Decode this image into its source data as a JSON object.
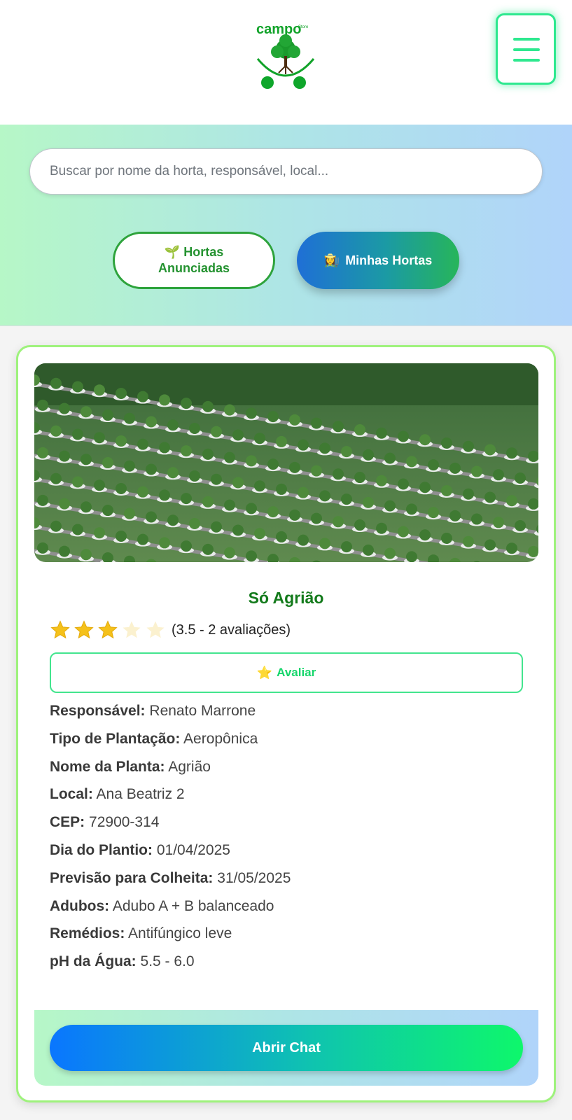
{
  "header": {
    "logo_text": "campo",
    "logo_subtext": "Store",
    "menu_icon": "hamburger-menu-icon"
  },
  "search": {
    "placeholder": "Buscar por nome da horta, responsável, local..."
  },
  "tabs": {
    "anunciadas": {
      "icon": "🌱",
      "label_line1": "Hortas",
      "label_line2": "Anunciadas"
    },
    "minhas": {
      "icon": "👩‍🌾",
      "label": "Minhas Hortas"
    }
  },
  "card": {
    "image_alt": "aeroponic watercress plantation",
    "title": "Só Agrião",
    "rating": {
      "value": 3.5,
      "stars_total": 5,
      "stars_filled": 3,
      "text": "(3.5 - 2 avaliações)"
    },
    "avaliar": {
      "icon": "⭐",
      "label": "Avaliar"
    },
    "details": [
      {
        "label": "Responsável:",
        "value": "Renato Marrone"
      },
      {
        "label": "Tipo de Plantação:",
        "value": "Aeropônica"
      },
      {
        "label": "Nome da Planta:",
        "value": "Agrião"
      },
      {
        "label": "Local:",
        "value": "Ana Beatriz 2"
      },
      {
        "label": "CEP:",
        "value": "72900-314"
      },
      {
        "label": "Dia do Plantio:",
        "value": "01/04/2025"
      },
      {
        "label": "Previsão para Colheita:",
        "value": "31/05/2025"
      },
      {
        "label": "Adubos:",
        "value": "Adubo A + B balanceado"
      },
      {
        "label": "Remédios:",
        "value": "Antifúngico leve"
      },
      {
        "label": "pH da Água:",
        "value": "5.5 - 6.0"
      }
    ],
    "chat_button": "Abrir Chat"
  },
  "colors": {
    "brand_green": "#137a1b",
    "accent_mint": "#2ee88f",
    "card_border": "#9ef27c"
  }
}
